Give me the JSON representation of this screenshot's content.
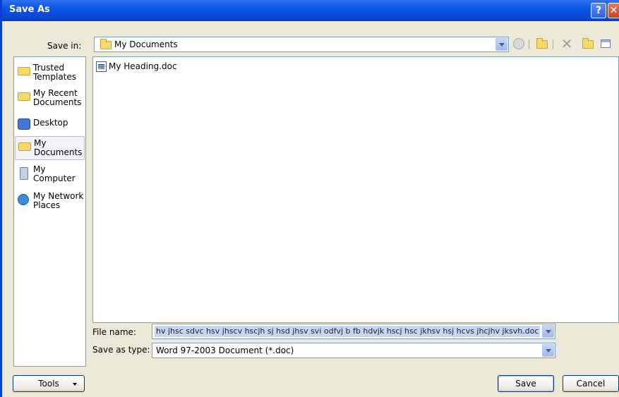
{
  "window": {
    "title": "Save As",
    "help_label": "?",
    "close_label": "✕"
  },
  "save_in": {
    "label": "Save in:",
    "value": "My Documents"
  },
  "toolbar": {
    "icons": [
      "back-icon",
      "up-folder-icon",
      "delete-icon",
      "new-folder-icon",
      "views-icon"
    ],
    "delete_glyph": "✕"
  },
  "places": [
    {
      "label": "Trusted Templates",
      "icon": "folder-icon"
    },
    {
      "label": "My Recent Documents",
      "icon": "folder-icon"
    },
    {
      "label": "Desktop",
      "icon": "desktop-icon"
    },
    {
      "label": "My Documents",
      "icon": "folder-icon",
      "selected": true
    },
    {
      "label": "My Computer",
      "icon": "computer-icon"
    },
    {
      "label": "My Network Places",
      "icon": "network-icon"
    }
  ],
  "files": [
    {
      "name": "My Heading.doc",
      "icon": "word-doc-icon"
    }
  ],
  "file_name": {
    "label": "File name:",
    "value": "hv jhsc sdvc hsv jhscv hscjh sj hsd jhsv svi odfvj b fb hdvjk hscj hsc jkhsv hsj hcvs jhcjhv jksvh.doc"
  },
  "save_as_type": {
    "label": "Save as type:",
    "value": "Word 97-2003 Document (*.doc)"
  },
  "buttons": {
    "tools": "Tools",
    "save": "Save",
    "cancel": "Cancel"
  },
  "colors": {
    "titlebar": "#0a54e6",
    "dialog_bg": "#ece9d8",
    "selection": "#c6d6f0"
  }
}
